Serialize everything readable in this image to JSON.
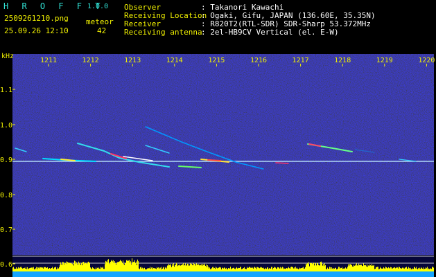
{
  "header": {
    "app_name": "H R O F F T",
    "version": "1.0.0",
    "filename": "2509261210.png",
    "datetime": "25.09.26 12:10",
    "meteor_label": "meteor",
    "meteor_count": "42",
    "info_labels": [
      "Observer",
      "Receiving Location",
      "Receiver",
      "Receiving antenna"
    ],
    "info_values": [
      ": Takanori Kawachi",
      ": Ogaki, Gifu, JAPAN (136.60E, 35.35N)",
      ": R820T2(RTL-SDR) SDR-Sharp 53.372MHz",
      ": 2el-HB9CV Vertical (el. E-W)"
    ]
  },
  "axis": {
    "y_unit": "kHz",
    "y_ticks": [
      "1.1",
      "1.0",
      "0.9",
      "0.8",
      "0.7",
      "0.6"
    ],
    "x_ticks": [
      "1211",
      "1212",
      "1213",
      "1214",
      "1215",
      "1216",
      "1217",
      "1218",
      "1219",
      "1220"
    ]
  },
  "colors": {
    "text_label": "#f2f200",
    "text_value": "#ffffff",
    "app_title": "#31e3d6",
    "noise_bg": "#0a0a55"
  }
}
